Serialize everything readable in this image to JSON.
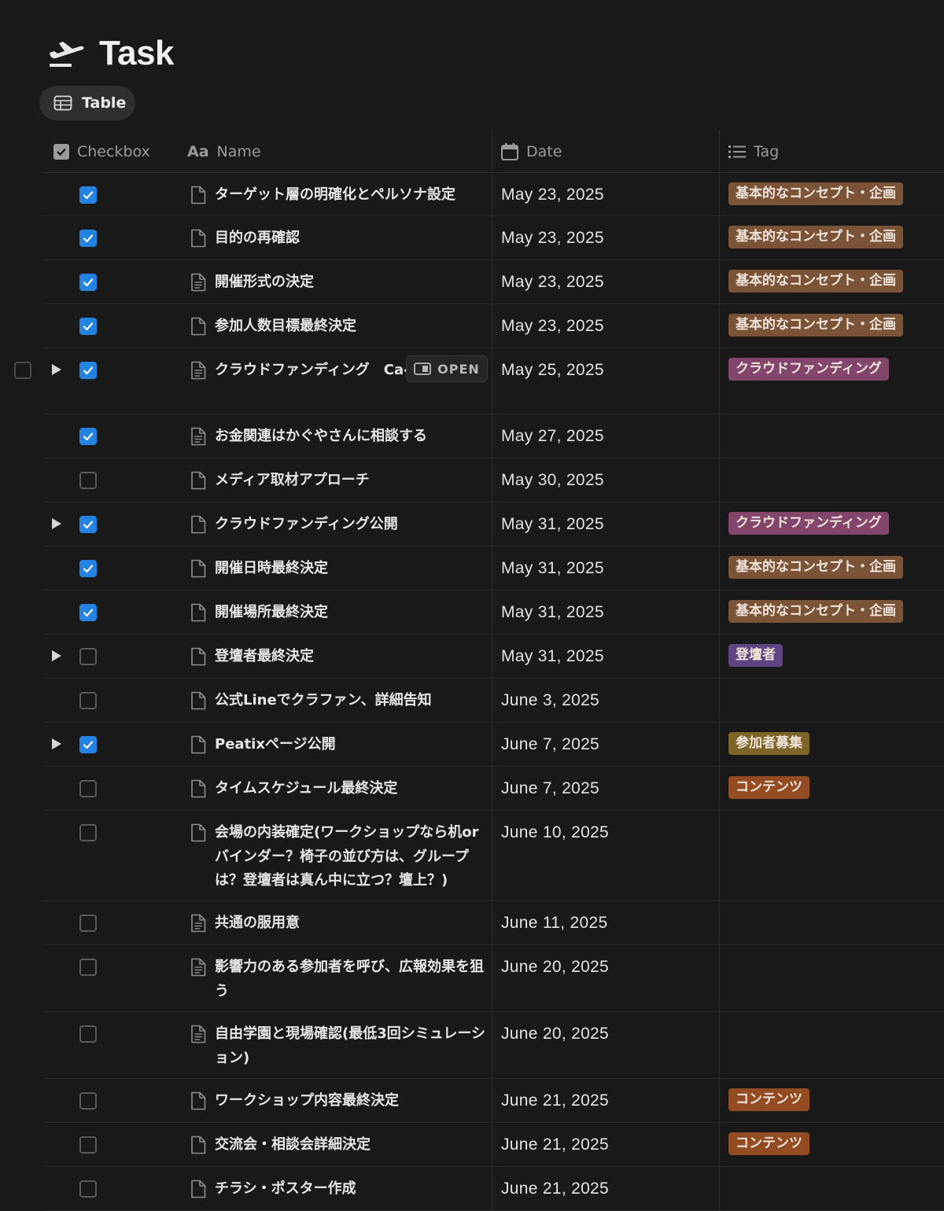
{
  "page": {
    "title": "Task",
    "view_tab_label": "Table"
  },
  "columns": {
    "checkbox": "Checkbox",
    "name": "Name",
    "date": "Date",
    "tag": "Tag"
  },
  "open_label": "OPEN",
  "tag_colors": {
    "基本的なコンセプト・企画": "#7b5438",
    "クラウドファンディング": "#83456a",
    "登壇者": "#5c4582",
    "参加者募集": "#7c6527",
    "コンテンツ": "#934b22"
  },
  "rows": [
    {
      "checked": true,
      "name": "ターゲット層の明確化とペルソナ設定",
      "date": "May 23, 2025",
      "tag": "基本的なコンセプト・企画",
      "toggle": false,
      "doc": "blank"
    },
    {
      "checked": true,
      "name": "目的の再確認",
      "date": "May 23, 2025",
      "tag": "基本的なコンセプト・企画",
      "toggle": false,
      "doc": "blank"
    },
    {
      "checked": true,
      "name": "開催形式の決定",
      "date": "May 23, 2025",
      "tag": "基本的なコンセプト・企画",
      "toggle": false,
      "doc": "text"
    },
    {
      "checked": true,
      "name": "参加人数目標最終決定",
      "date": "May 23, 2025",
      "tag": "基本的なコンセプト・企画",
      "toggle": false,
      "doc": "blank"
    },
    {
      "checked": true,
      "name": "クラウドファンディング　Caページ作成",
      "date": "May 25, 2025",
      "tag": "クラウドファンディング",
      "toggle": true,
      "doc": "text",
      "hover": true
    },
    {
      "checked": true,
      "name": "お金関連はかぐやさんに相談する",
      "date": "May 27, 2025",
      "tag": "",
      "toggle": false,
      "doc": "text"
    },
    {
      "checked": false,
      "name": "メディア取材アプローチ",
      "date": "May 30, 2025",
      "tag": "",
      "toggle": false,
      "doc": "blank"
    },
    {
      "checked": true,
      "name": "クラウドファンディング公開",
      "date": "May 31, 2025",
      "tag": "クラウドファンディング",
      "toggle": true,
      "doc": "blank"
    },
    {
      "checked": true,
      "name": "開催日時最終決定",
      "date": "May 31, 2025",
      "tag": "基本的なコンセプト・企画",
      "toggle": false,
      "doc": "blank"
    },
    {
      "checked": true,
      "name": "開催場所最終決定",
      "date": "May 31, 2025",
      "tag": "基本的なコンセプト・企画",
      "toggle": false,
      "doc": "blank"
    },
    {
      "checked": false,
      "name": "登壇者最終決定",
      "date": "May 31, 2025",
      "tag": "登壇者",
      "toggle": true,
      "doc": "blank"
    },
    {
      "checked": false,
      "name": "公式Lineでクラファン、詳細告知",
      "date": "June 3, 2025",
      "tag": "",
      "toggle": false,
      "doc": "blank"
    },
    {
      "checked": true,
      "name": "Peatixページ公開",
      "date": "June 7, 2025",
      "tag": "参加者募集",
      "toggle": true,
      "doc": "blank"
    },
    {
      "checked": false,
      "name": "タイムスケジュール最終決定",
      "date": "June 7, 2025",
      "tag": "コンテンツ",
      "toggle": false,
      "doc": "blank"
    },
    {
      "checked": false,
      "name": "会場の内装確定(ワークショップなら机orバインダー？椅子の並び方は、グループは？登壇者は真ん中に立つ？壇上？)",
      "date": "June 10, 2025",
      "tag": "",
      "toggle": false,
      "doc": "blank"
    },
    {
      "checked": false,
      "name": "共通の服用意",
      "date": "June 11, 2025",
      "tag": "",
      "toggle": false,
      "doc": "text"
    },
    {
      "checked": false,
      "name": "影響力のある参加者を呼び、広報効果を狙う",
      "date": "June 20, 2025",
      "tag": "",
      "toggle": false,
      "doc": "text"
    },
    {
      "checked": false,
      "name": "自由学園と現場確認(最低3回シミュレーション)",
      "date": "June 20, 2025",
      "tag": "",
      "toggle": false,
      "doc": "text"
    },
    {
      "checked": false,
      "name": "ワークショップ内容最終決定",
      "date": "June 21, 2025",
      "tag": "コンテンツ",
      "toggle": false,
      "doc": "blank"
    },
    {
      "checked": false,
      "name": "交流会・相談会詳細決定",
      "date": "June 21, 2025",
      "tag": "コンテンツ",
      "toggle": false,
      "doc": "blank"
    },
    {
      "checked": false,
      "name": "チラシ・ポスター作成",
      "date": "June 21, 2025",
      "tag": "",
      "toggle": false,
      "doc": "blank"
    }
  ]
}
